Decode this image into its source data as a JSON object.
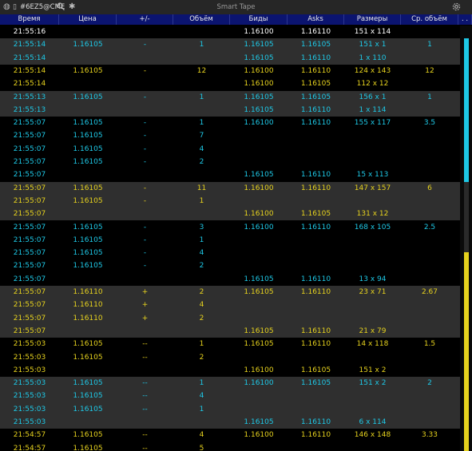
{
  "window": {
    "symbol": "#6EZ5@CME",
    "title": "Smart Tape"
  },
  "columns": [
    "Время",
    "Цена",
    "+/-",
    "Объём",
    "Биды",
    "Asks",
    "Размеры",
    "Ср. объём",
    ". ."
  ],
  "colors": {
    "cyan": "#1ec8e6",
    "yellow": "#e6d21e",
    "white": "#ffffff",
    "header_bg": "#0b1470",
    "group_bg": "#2f2f2f",
    "group_bg_alt": "#000000"
  },
  "rows": [
    {
      "cells": [
        "21:55:16",
        "",
        "",
        "",
        "1.16100",
        "1.16110",
        "151 x 114",
        ""
      ],
      "color": "white",
      "bg": "#000000"
    },
    {
      "cells": [
        "21:55:14",
        "1.16105",
        "-",
        "1",
        "1.16105",
        "1.16105",
        "151 x 1",
        "1"
      ],
      "color": "cyan",
      "bg": "#2f2f2f"
    },
    {
      "cells": [
        "21:55:14",
        "",
        "",
        "",
        "1.16105",
        "1.16110",
        "1 x 110",
        ""
      ],
      "color": "cyan",
      "bg": "#2f2f2f"
    },
    {
      "cells": [
        "21:55:14",
        "1.16105",
        "-",
        "12",
        "1.16100",
        "1.16110",
        "124 x 143",
        "12"
      ],
      "color": "yellow",
      "bg": "#000000"
    },
    {
      "cells": [
        "21:55:14",
        "",
        "",
        "",
        "1.16100",
        "1.16105",
        "112 x 12",
        ""
      ],
      "color": "yellow",
      "bg": "#000000"
    },
    {
      "cells": [
        "21:55:13",
        "1.16105",
        "-",
        "1",
        "1.16105",
        "1.16105",
        "156 x 1",
        "1"
      ],
      "color": "cyan",
      "bg": "#2f2f2f"
    },
    {
      "cells": [
        "21:55:13",
        "",
        "",
        "",
        "1.16105",
        "1.16110",
        "1 x 114",
        ""
      ],
      "color": "cyan",
      "bg": "#2f2f2f"
    },
    {
      "cells": [
        "21:55:07",
        "1.16105",
        "-",
        "1",
        "1.16100",
        "1.16110",
        "155 x 117",
        "3.5"
      ],
      "color": "cyan",
      "bg": "#000000"
    },
    {
      "cells": [
        "21:55:07",
        "1.16105",
        "-",
        "7",
        "",
        "",
        "",
        ""
      ],
      "color": "cyan",
      "bg": "#000000"
    },
    {
      "cells": [
        "21:55:07",
        "1.16105",
        "-",
        "4",
        "",
        "",
        "",
        ""
      ],
      "color": "cyan",
      "bg": "#000000"
    },
    {
      "cells": [
        "21:55:07",
        "1.16105",
        "-",
        "2",
        "",
        "",
        "",
        ""
      ],
      "color": "cyan",
      "bg": "#000000"
    },
    {
      "cells": [
        "21:55:07",
        "",
        "",
        "",
        "1.16105",
        "1.16110",
        "15 x 113",
        ""
      ],
      "color": "cyan",
      "bg": "#000000"
    },
    {
      "cells": [
        "21:55:07",
        "1.16105",
        "-",
        "11",
        "1.16100",
        "1.16110",
        "147 x 157",
        "6"
      ],
      "color": "yellow",
      "bg": "#2f2f2f"
    },
    {
      "cells": [
        "21:55:07",
        "1.16105",
        "-",
        "1",
        "",
        "",
        "",
        ""
      ],
      "color": "yellow",
      "bg": "#2f2f2f"
    },
    {
      "cells": [
        "21:55:07",
        "",
        "",
        "",
        "1.16100",
        "1.16105",
        "131 x 12",
        ""
      ],
      "color": "yellow",
      "bg": "#2f2f2f"
    },
    {
      "cells": [
        "21:55:07",
        "1.16105",
        "-",
        "3",
        "1.16100",
        "1.16110",
        "168 x 105",
        "2.5"
      ],
      "color": "cyan",
      "bg": "#000000"
    },
    {
      "cells": [
        "21:55:07",
        "1.16105",
        "-",
        "1",
        "",
        "",
        "",
        ""
      ],
      "color": "cyan",
      "bg": "#000000"
    },
    {
      "cells": [
        "21:55:07",
        "1.16105",
        "-",
        "4",
        "",
        "",
        "",
        ""
      ],
      "color": "cyan",
      "bg": "#000000"
    },
    {
      "cells": [
        "21:55:07",
        "1.16105",
        "-",
        "2",
        "",
        "",
        "",
        ""
      ],
      "color": "cyan",
      "bg": "#000000"
    },
    {
      "cells": [
        "21:55:07",
        "",
        "",
        "",
        "1.16105",
        "1.16110",
        "13 x 94",
        ""
      ],
      "color": "cyan",
      "bg": "#000000"
    },
    {
      "cells": [
        "21:55:07",
        "1.16110",
        "+",
        "2",
        "1.16105",
        "1.16110",
        "23 x 71",
        "2.67"
      ],
      "color": "yellow",
      "bg": "#2f2f2f"
    },
    {
      "cells": [
        "21:55:07",
        "1.16110",
        "+",
        "4",
        "",
        "",
        "",
        ""
      ],
      "color": "yellow",
      "bg": "#2f2f2f"
    },
    {
      "cells": [
        "21:55:07",
        "1.16110",
        "+",
        "2",
        "",
        "",
        "",
        ""
      ],
      "color": "yellow",
      "bg": "#2f2f2f"
    },
    {
      "cells": [
        "21:55:07",
        "",
        "",
        "",
        "1.16105",
        "1.16110",
        "21 x 79",
        ""
      ],
      "color": "yellow",
      "bg": "#2f2f2f"
    },
    {
      "cells": [
        "21:55:03",
        "1.16105",
        "--",
        "1",
        "1.16105",
        "1.16110",
        "14 x 118",
        "1.5"
      ],
      "color": "yellow",
      "bg": "#000000"
    },
    {
      "cells": [
        "21:55:03",
        "1.16105",
        "--",
        "2",
        "",
        "",
        "",
        ""
      ],
      "color": "yellow",
      "bg": "#000000"
    },
    {
      "cells": [
        "21:55:03",
        "",
        "",
        "",
        "1.16100",
        "1.16105",
        "151 x 2",
        ""
      ],
      "color": "yellow",
      "bg": "#000000"
    },
    {
      "cells": [
        "21:55:03",
        "1.16105",
        "--",
        "1",
        "1.16100",
        "1.16105",
        "151 x 2",
        "2"
      ],
      "color": "cyan",
      "bg": "#2f2f2f"
    },
    {
      "cells": [
        "21:55:03",
        "1.16105",
        "--",
        "4",
        "",
        "",
        "",
        ""
      ],
      "color": "cyan",
      "bg": "#2f2f2f"
    },
    {
      "cells": [
        "21:55:03",
        "1.16105",
        "--",
        "1",
        "",
        "",
        "",
        ""
      ],
      "color": "cyan",
      "bg": "#2f2f2f"
    },
    {
      "cells": [
        "21:55:03",
        "",
        "",
        "",
        "1.16105",
        "1.16110",
        "6 x 114",
        ""
      ],
      "color": "cyan",
      "bg": "#2f2f2f"
    },
    {
      "cells": [
        "21:54:57",
        "1.16105",
        "--",
        "4",
        "1.16100",
        "1.16110",
        "146 x 148",
        "3.33"
      ],
      "color": "yellow",
      "bg": "#000000"
    },
    {
      "cells": [
        "21:54:57",
        "1.16105",
        "--",
        "5",
        "",
        "",
        "",
        ""
      ],
      "color": "yellow",
      "bg": "#000000"
    }
  ],
  "scroll_position": 0,
  "icons": [
    "link-icon",
    "phone-icon",
    "search-icon",
    "asterisk-icon",
    "settings-gear-icon"
  ]
}
